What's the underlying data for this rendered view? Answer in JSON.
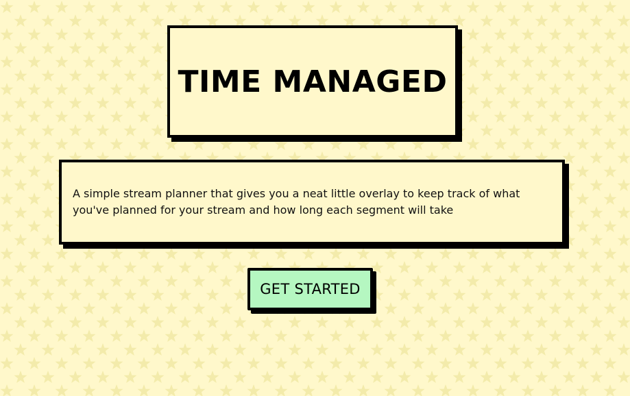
{
  "page": {
    "background_color": "#fff8cb",
    "pattern_star_color": "#f3ebab",
    "pattern_icon": "star-icon"
  },
  "header": {
    "title": "TIME MANAGED"
  },
  "intro": {
    "description": "A simple stream planner that gives you a neat little overlay to keep track of what you've planned for your stream and how long each segment will take"
  },
  "cta": {
    "label": "GET STARTED",
    "background_color": "#b5f7c1"
  }
}
